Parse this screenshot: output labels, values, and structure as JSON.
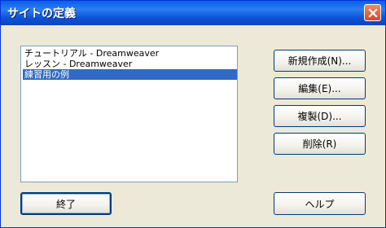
{
  "window": {
    "title": "サイトの定義"
  },
  "site_list": {
    "items": [
      {
        "label": "チュートリアル - Dreamweaver",
        "selected": false
      },
      {
        "label": "レッスン - Dreamweaver",
        "selected": false
      },
      {
        "label": "練習用の例",
        "selected": true
      }
    ]
  },
  "buttons": {
    "new": "新規作成(N)...",
    "edit": "編集(E)...",
    "duplicate": "複製(D)...",
    "delete": "削除(R)",
    "done": "終了",
    "help": "ヘルプ"
  },
  "icons": {
    "close": "close-icon"
  },
  "colors": {
    "titlebar": "#0a5ee8",
    "selection": "#316ac5",
    "close_button": "#d8482a",
    "dialog_bg": "#ece9d8"
  }
}
